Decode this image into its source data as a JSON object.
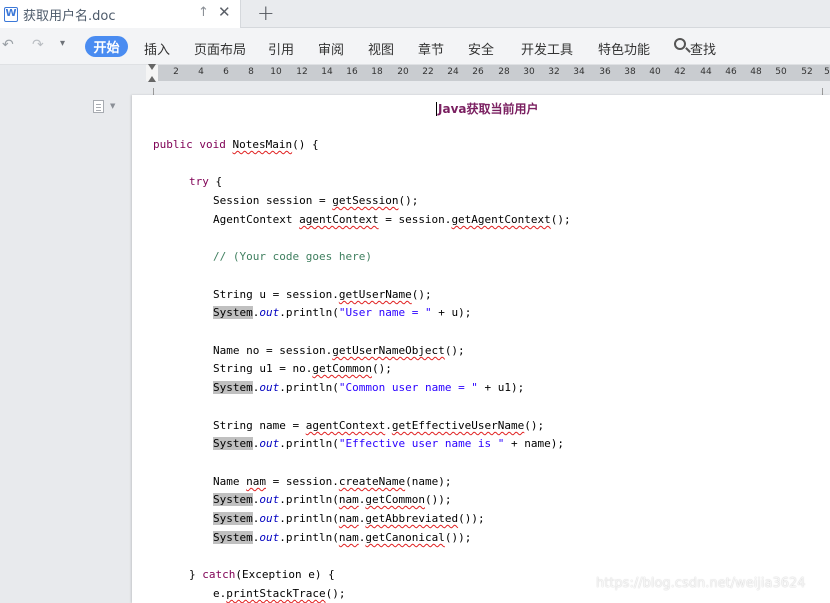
{
  "tab": {
    "title": "获取用户名.doc",
    "icon_letter": "W"
  },
  "menu": {
    "active": "开始",
    "items": [
      "插入",
      "页面布局",
      "引用",
      "审阅",
      "视图",
      "章节",
      "安全",
      "开发工具",
      "特色功能"
    ],
    "search_label": "查找"
  },
  "ruler": {
    "numbers": [
      "2",
      "4",
      "6",
      "8",
      "10",
      "12",
      "14",
      "16",
      "18",
      "20",
      "22",
      "24",
      "26",
      "28",
      "30",
      "32",
      "34",
      "36",
      "38",
      "40",
      "42",
      "44",
      "46",
      "48",
      "50",
      "52",
      "5"
    ]
  },
  "document": {
    "title": "Java获取当前用户",
    "lines": [
      "public void NotesMain() {",
      "try {",
      "Session session = getSession();",
      "AgentContext agentContext = session.getAgentContext();",
      "// (Your code goes here)",
      "String u = session.getUserName();",
      "System.out.println(\"User name = \" + u);",
      "Name no = session.getUserNameObject();",
      "String u1 = no.getCommon();",
      "System.out.println(\"Common user name = \" + u1);",
      "String name = agentContext.getEffectiveUserName();",
      "System.out.println(\"Effective user name is \" + name);",
      "Name nam = session.createName(name);",
      "System.out.println(nam.getCommon());",
      "System.out.println(nam.getAbbreviated());",
      "System.out.println(nam.getCanonical());",
      "} catch(Exception e) {",
      "e.printStackTrace();"
    ]
  },
  "watermark": "https://blog.csdn.net/weijia3624",
  "colors": {
    "accent": "#4a8cf1",
    "keyword": "#7f0055",
    "string": "#2a00ff",
    "comment": "#3f7f5f",
    "title": "#7a1f60"
  }
}
